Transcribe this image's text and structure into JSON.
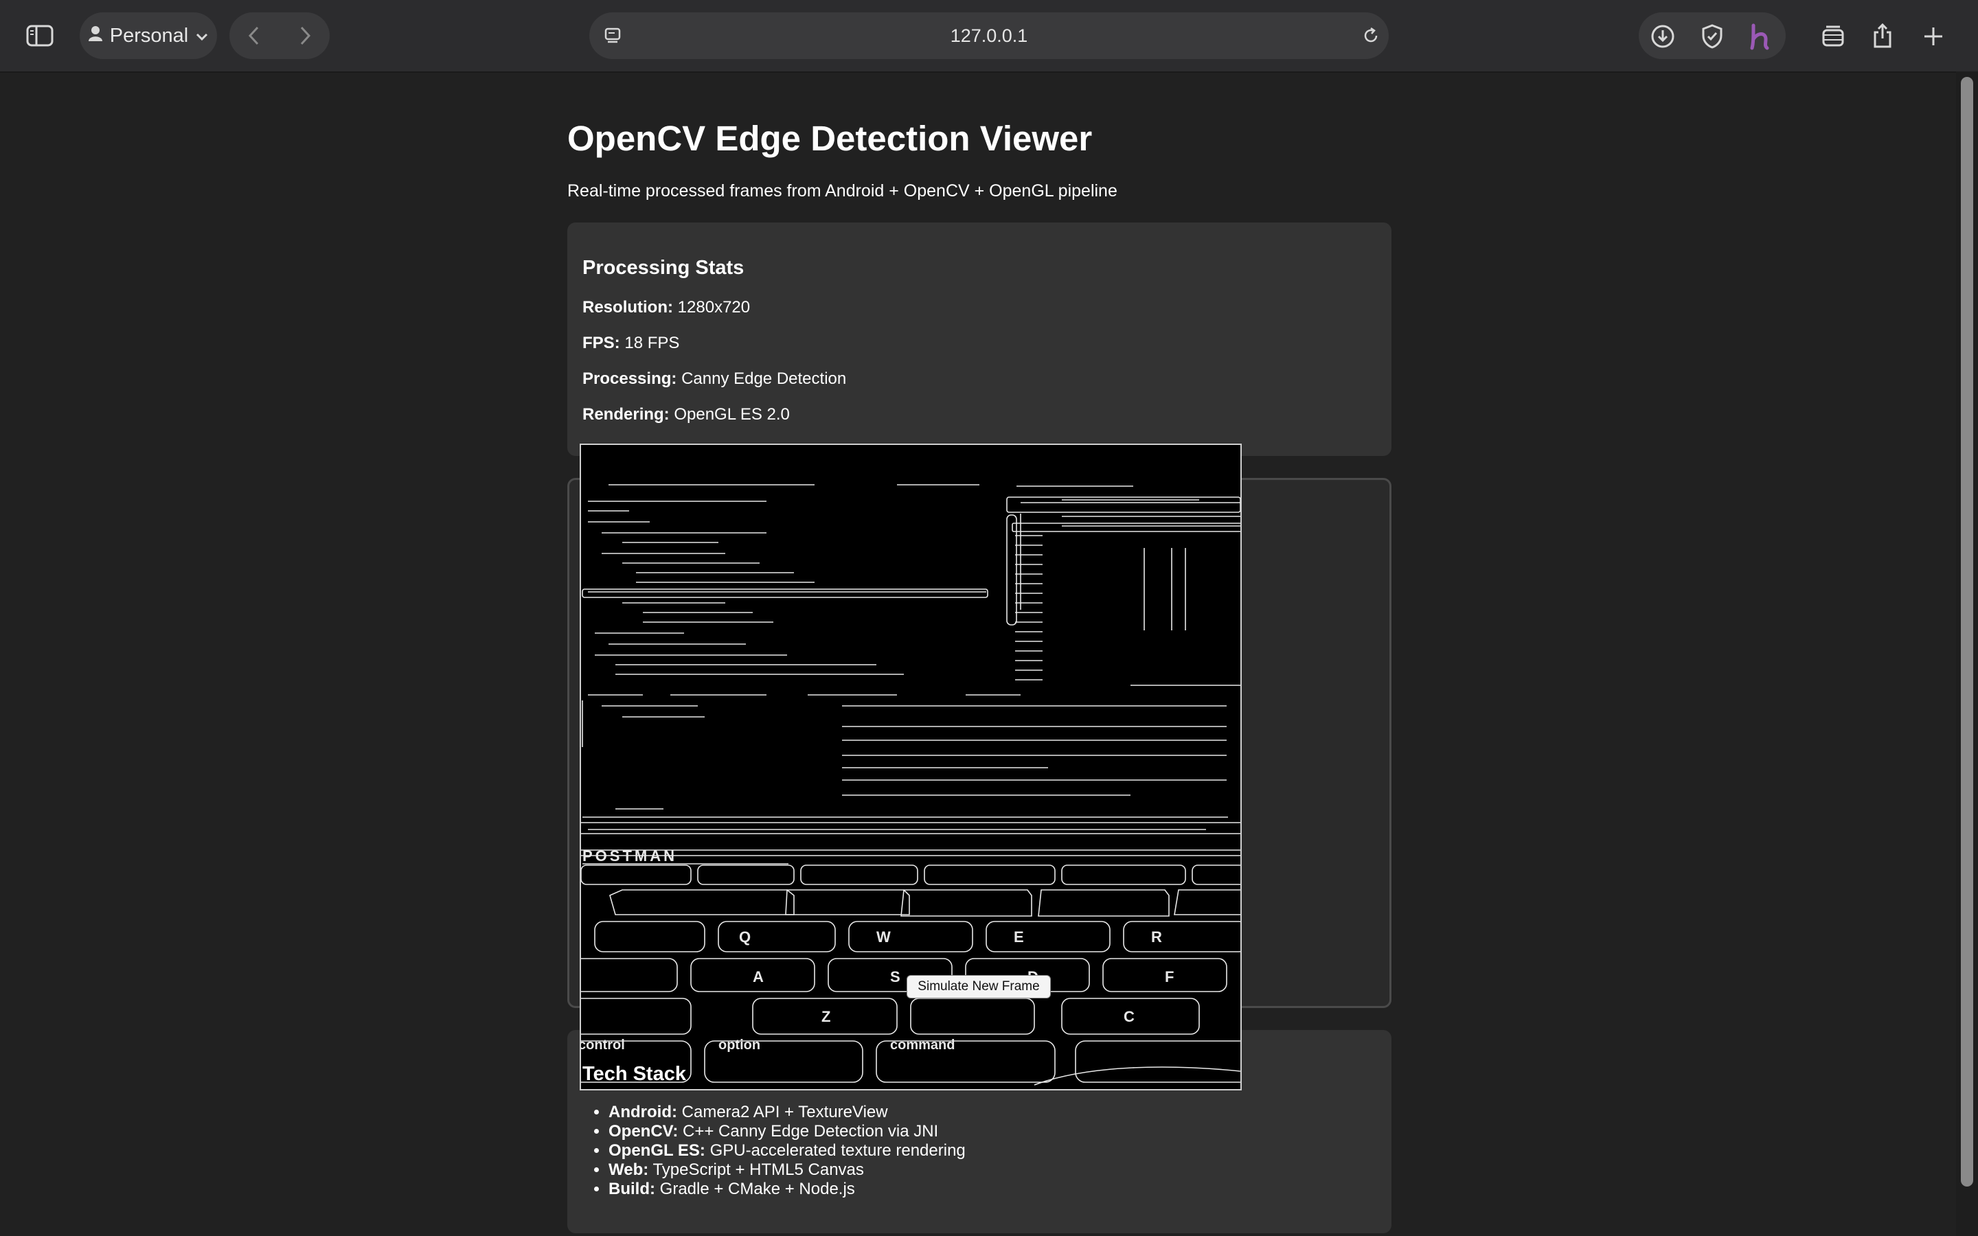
{
  "browser": {
    "profile_label": "Personal",
    "url": "127.0.0.1",
    "icons": [
      "sidebar-icon",
      "person-icon",
      "chevron-down-icon",
      "back-icon",
      "forward-icon",
      "page-menu-icon",
      "reload-icon",
      "download-icon",
      "shield-icon",
      "honey-extension-icon",
      "tab-overview-icon",
      "share-icon",
      "new-tab-icon"
    ]
  },
  "page": {
    "title": "OpenCV Edge Detection Viewer",
    "subtitle": "Real-time processed frames from Android + OpenCV + OpenGL pipeline"
  },
  "stats": {
    "heading": "Processing Stats",
    "items": [
      {
        "label": "Resolution:",
        "value": "1280x720"
      },
      {
        "label": "FPS:",
        "value": "18 FPS"
      },
      {
        "label": "Processing:",
        "value": "Canny Edge Detection"
      },
      {
        "label": "Rendering:",
        "value": "OpenGL ES 2.0"
      }
    ]
  },
  "frame": {
    "button_label": "Simulate New Frame",
    "keyboard_text": [
      "POSTMAN",
      "Q",
      "W",
      "E",
      "R",
      "A",
      "S",
      "D",
      "F",
      "Z",
      "C",
      "option",
      "command",
      "control"
    ]
  },
  "tech": {
    "heading": "Tech Stack",
    "items": [
      {
        "label": "Android:",
        "value": "Camera2 API + TextureView"
      },
      {
        "label": "OpenCV:",
        "value": "C++ Canny Edge Detection via JNI"
      },
      {
        "label": "OpenGL ES:",
        "value": "GPU-accelerated texture rendering"
      },
      {
        "label": "Web:",
        "value": "TypeScript + HTML5 Canvas"
      },
      {
        "label": "Build:",
        "value": "Gradle + CMake + Node.js"
      }
    ]
  },
  "colors": {
    "background": "#212121",
    "card": "#333333",
    "toolbar": "#2c2c2e",
    "honey_accent": "#9b59b6"
  }
}
